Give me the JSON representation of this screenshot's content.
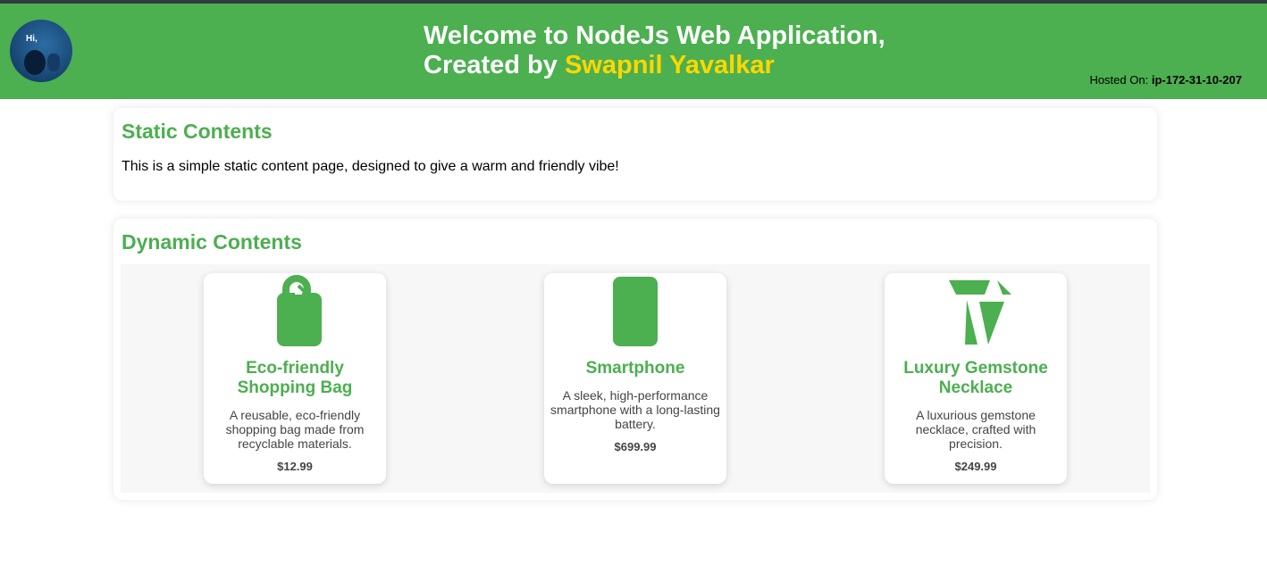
{
  "header": {
    "title_line1": "Welcome to NodeJs Web Application,",
    "title_line2_prefix": "Created by",
    "author": "Swapnil Yavalkar",
    "hosted_label": "Hosted On:",
    "hosted_value": "ip-172-31-10-207",
    "avatar_text": "Hi,"
  },
  "static_section": {
    "heading": "Static Contents",
    "text": "This is a simple static content page, designed to give a warm and friendly vibe!"
  },
  "dynamic_section": {
    "heading": "Dynamic Contents",
    "products": [
      {
        "name": "Eco-friendly Shopping Bag",
        "description": "A reusable, eco-friendly shopping bag made from recyclable materials.",
        "price": "$12.99",
        "icon": "shopping-bag-icon"
      },
      {
        "name": "Smartphone",
        "description": "A sleek, high-performance smartphone with a long-lasting battery.",
        "price": "$699.99",
        "icon": "smartphone-icon"
      },
      {
        "name": "Luxury Gemstone Necklace",
        "description": "A luxurious gemstone necklace, crafted with precision.",
        "price": "$249.99",
        "icon": "gem-icon"
      }
    ]
  },
  "colors": {
    "accent": "#4caf50",
    "author": "#ffd700",
    "topbar": "#2e3c42"
  }
}
